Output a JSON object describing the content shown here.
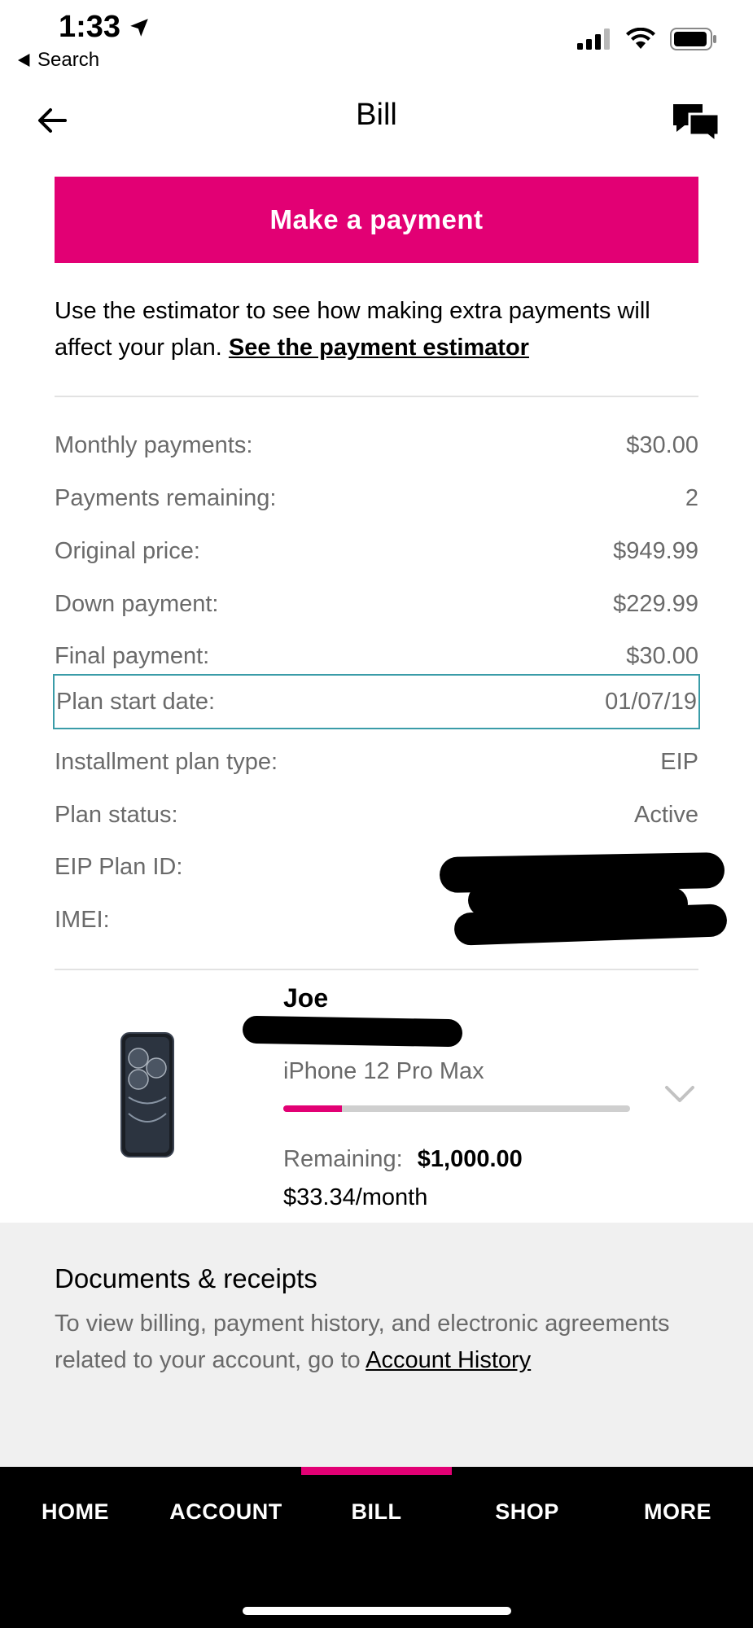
{
  "status_bar": {
    "time": "1:33",
    "back_label": "Search"
  },
  "header": {
    "title": "Bill"
  },
  "payment_button": {
    "label": "Make a payment"
  },
  "estimator": {
    "text": "Use the estimator to see how making extra payments will affect your plan.",
    "link": "See the payment estimator"
  },
  "details": [
    {
      "label": "Monthly payments:",
      "value": "$30.00"
    },
    {
      "label": "Payments remaining:",
      "value": "2"
    },
    {
      "label": "Original price:",
      "value": "$949.99"
    },
    {
      "label": "Down payment:",
      "value": "$229.99"
    },
    {
      "label": "Final payment:",
      "value": "$30.00"
    },
    {
      "label": "Plan start date:",
      "value": "01/07/19"
    },
    {
      "label": "Installment plan type:",
      "value": "EIP"
    },
    {
      "label": "Plan status:",
      "value": "Active"
    },
    {
      "label": "EIP Plan ID:",
      "value": ""
    },
    {
      "label": "IMEI:",
      "value": ""
    }
  ],
  "device": {
    "owner": "Joe",
    "model": "iPhone 12 Pro Max",
    "progress_fraction": 0.17,
    "remaining_label": "Remaining:",
    "remaining_value": "$1,000.00",
    "monthly": "$33.34/month"
  },
  "documents": {
    "title": "Documents & receipts",
    "text": "To view billing, payment history, and electronic agreements related to your account, go to",
    "link": "Account History"
  },
  "nav": {
    "items": [
      "HOME",
      "ACCOUNT",
      "BILL",
      "SHOP",
      "MORE"
    ],
    "active": "BILL"
  },
  "colors": {
    "accent": "#e20074",
    "highlight_border": "#3a9ca8",
    "muted_text": "#6a6a6a"
  }
}
